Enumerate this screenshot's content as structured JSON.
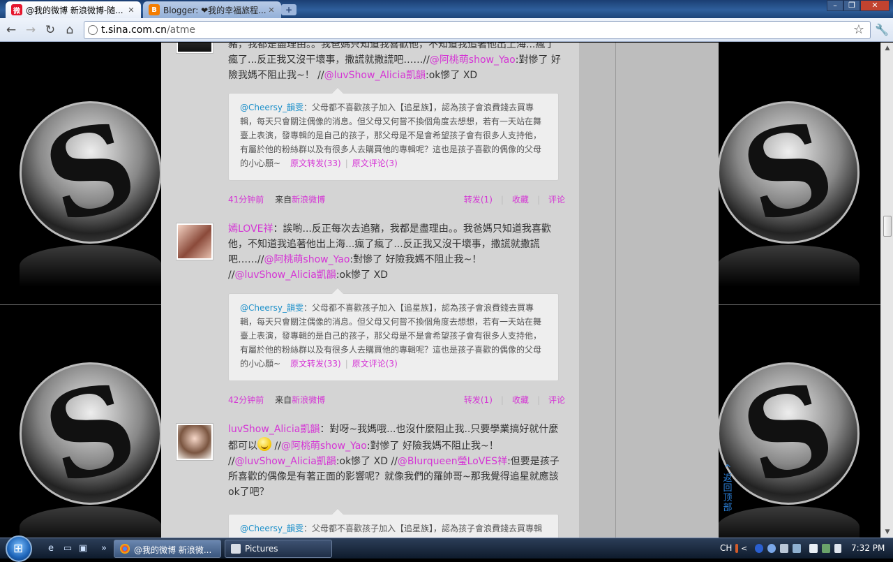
{
  "browser": {
    "tabs": [
      {
        "title": "@我的微博 新浪微博-随...",
        "favicon": "weibo-icon",
        "active": true
      },
      {
        "title": "Blogger: ❤我的幸福旅程...",
        "favicon": "blogger-icon",
        "active": false
      }
    ],
    "url": {
      "host": "t.sina.com.cn",
      "path": "/atme"
    },
    "nav_icons": [
      "back-icon",
      "forward-icon",
      "reload-icon",
      "home-icon",
      "star-icon",
      "wrench-icon"
    ]
  },
  "feed": {
    "top_partial": {
      "line1": "豬，我都是盡理由。。我爸媽只知道我喜歡他，不知道我追著他出上海...瘋了",
      "line2_a": "瘋了...反正我又沒干壞事，撒謊就撒謊吧……//",
      "mention1": "@阿桃萌show_Yao",
      "line2_b": ":對慘了 好",
      "line3_a": "險我媽不阻止我~！  //",
      "mention2": "@luvShow_Alicia凱韻",
      "line3_b": ":ok慘了 XD",
      "quote": {
        "user": "@Cheersy_韻雯",
        "text": "：父母都不喜歡孩子加入【追星族】，認為孩子會浪費錢去買專輯，每天只會關注偶像的消息。但父母又何嘗不換個角度去想想，若有一天站在舞臺上表演，發專輯的是自己的孩子，那父母是不是會希望孩子會有很多人支持他，有屬於他的粉絲群以及有很多人去購買他的專輯呢？這也是孩子喜歡的偶像的父母的小心願~",
        "repost_link": "原文转发(33)",
        "comment_link": "原文评论(3)"
      },
      "meta": {
        "time": "41分钟前",
        "source_prefix": "来自",
        "source": "新浪微博",
        "repost": "转发(1)",
        "favorite": "收藏",
        "comment": "评论"
      }
    },
    "post2": {
      "user": "嫣LOVE祥",
      "text_a": "：誒喲...反正每次去追豬，我都是盡理由。。我爸媽只知道我喜歡他，不知道我追著他出上海...瘋了瘋了...反正我又沒干壞事，撒謊就撒謊吧……//",
      "mention1": "@阿桃萌show_Yao",
      "text_b": ":對慘了 好險我媽不阻止我~！ //",
      "mention2": "@luvShow_Alicia凱韻",
      "text_c": ":ok慘了 XD",
      "quote": {
        "user": "@Cheersy_韻雯",
        "text": "：父母都不喜歡孩子加入【追星族】，認為孩子會浪費錢去買專輯，每天只會關注偶像的消息。但父母又何嘗不換個角度去想想，若有一天站在舞臺上表演，發專輯的是自己的孩子，那父母是不是會希望孩子會有很多人支持他，有屬於他的粉絲群以及有很多人去購買他的專輯呢？這也是孩子喜歡的偶像的父母的小心願~",
        "repost_link": "原文转发(33)",
        "comment_link": "原文评论(3)"
      },
      "meta": {
        "time": "42分钟前",
        "source_prefix": "来自",
        "source": "新浪微博",
        "repost": "转发(1)",
        "favorite": "收藏",
        "comment": "评论"
      }
    },
    "post3": {
      "user": "luvShow_Alicia凱韻",
      "text_a": "：對呀~我媽哦...也沒什麼阻止我..只要學業搞好就什麼都可以",
      "text_b": " //",
      "mention1": "@阿桃萌show_Yao",
      "text_c": ":對慘了 好險我媽不阻止我~！ //",
      "mention2": "@luvShow_Alicia凱韻",
      "text_d": ":ok慘了 XD //",
      "mention3": "@Blurqueen瑩LoVES祥",
      "text_e": ":但要是孩子所喜歡的偶像是有著正面的影響呢？就像我們的羅帥哥~那我覺得追星就應該ok了吧？",
      "quote": {
        "user": "@Cheersy_韻雯",
        "text": "：父母都不喜歡孩子加入【追星族】，認為孩子會浪費錢去買專輯"
      }
    },
    "back_to_top": "返回顶部"
  },
  "taskbar": {
    "buttons": [
      {
        "label": "@我的微博 新浪微...",
        "icon": "chrome-icon",
        "active": true
      },
      {
        "label": "Pictures",
        "icon": "folder-icon",
        "active": false
      }
    ],
    "lang": "CH",
    "clock": "7:32 PM"
  },
  "colors": {
    "mention": "#d535d5",
    "quote_user": "#1b8fc9",
    "feed_bg": "#d4d4d4"
  }
}
